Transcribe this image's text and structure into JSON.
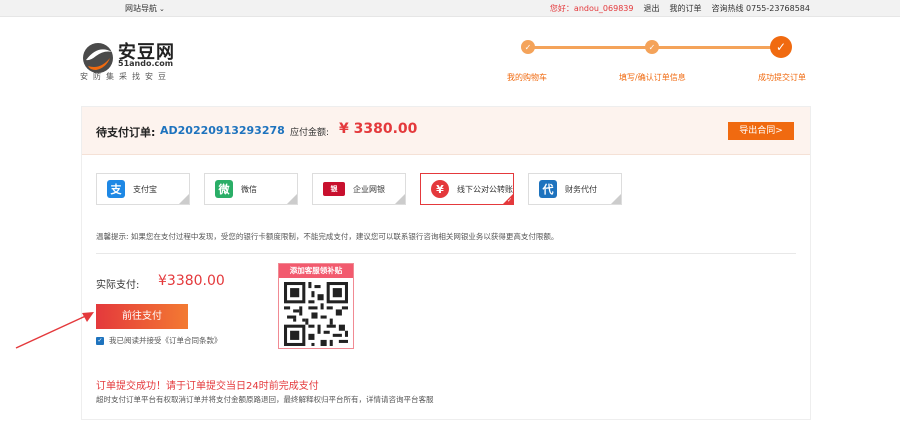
{
  "topbar": {
    "nav_label": "网站导航",
    "greeting": "您好：andou_069839",
    "logout": "退出",
    "my_orders": "我的订单",
    "hotline": "咨询热线 0755-23768584"
  },
  "logo": {
    "name": "安豆网",
    "domain": "51ando.com",
    "slogan": "安防集采找安豆"
  },
  "steps": [
    {
      "label": "我的购物车"
    },
    {
      "label": "填写/确认订单信息"
    },
    {
      "label": "成功提交订单"
    }
  ],
  "order": {
    "label": "待支付订单:",
    "id": "AD20220913293278",
    "amount_label": "应付金额:",
    "amount": "¥ 3380.00",
    "export_button": "导出合同>"
  },
  "payment_methods": [
    {
      "label": "支付宝",
      "icon": "alipay-icon",
      "color": "#1e88e5",
      "glyph": "支"
    },
    {
      "label": "微信",
      "icon": "wechat-icon",
      "color": "#2aae67",
      "glyph": "微"
    },
    {
      "label": "企业网银",
      "icon": "unionpay-icon",
      "color": "#c8102e",
      "glyph": "银"
    },
    {
      "label": "线下公对公转账",
      "icon": "bank-transfer-icon",
      "color": "#e4393c",
      "glyph": "转",
      "active": true
    },
    {
      "label": "财务代付",
      "icon": "finance-icon",
      "color": "#1e73be",
      "glyph": "代"
    }
  ],
  "tip": "温馨提示: 如果您在支付过程中发现，受您的银行卡额度限制，不能完成支付，建议您可以联系银行咨询相关网银业务以获得更高支付限额。",
  "pay": {
    "label": "实际支付:",
    "amount": "¥3380.00",
    "button": "前往支付",
    "agree_text": "我已阅读并接受《订单合同条款》"
  },
  "qr": {
    "title": "添加客服领补贴"
  },
  "notice": {
    "success": "订单提交成功！请于订单提交当日24时前完成支付",
    "detail": "超时支付订单平台有权取消订单并将支付金额原路退回，最终解释权归平台所有，详情请咨询平台客服"
  },
  "colors": {
    "accent": "#f06a10",
    "price": "#e4393c",
    "link": "#1e73be"
  }
}
